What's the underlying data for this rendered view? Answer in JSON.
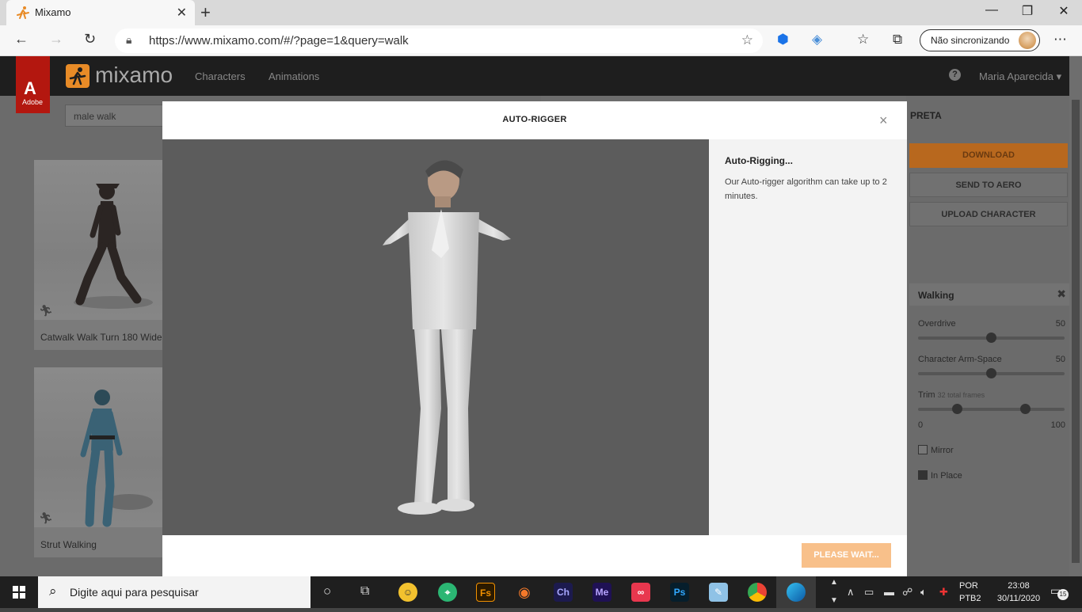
{
  "browser": {
    "tab_title": "Mixamo",
    "tab_close": "✕",
    "new_tab": "+",
    "url": "https://www.mixamo.com/#/?page=1&query=walk",
    "sync_label": "Não sincronizando",
    "minimize": "—",
    "restore": "❐",
    "close": "✕"
  },
  "mixamo": {
    "adobe_label": "Adobe",
    "logo_text": "mixamo",
    "nav": [
      "Characters",
      "Animations"
    ],
    "help": "?",
    "user_name": "Maria Aparecida",
    "search_value": "male walk",
    "cards": [
      {
        "label": "Catwalk Walk Turn 180 Wide"
      },
      {
        "label": "Strut Walking"
      }
    ],
    "right_panel": {
      "title": "PRETA",
      "download": "DOWNLOAD",
      "send_to_aero": "SEND TO AERO",
      "upload_character": "UPLOAD CHARACTER",
      "anim_name": "Walking",
      "sliders": [
        {
          "label": "Overdrive",
          "value": "50",
          "level": 0.5
        },
        {
          "label": "Character Arm-Space",
          "value": "50",
          "level": 0.5
        }
      ],
      "trim_label": "Trim",
      "trim_frames": "32 total frames",
      "trim_min": "0",
      "trim_max": "100",
      "trim_range": [
        0.27,
        0.73
      ],
      "mirror_label": "Mirror",
      "mirror_checked": false,
      "in_place_label": "In Place",
      "in_place_checked": true
    }
  },
  "modal": {
    "title": "AUTO-RIGGER",
    "close": "×",
    "info_title": "Auto-Rigging...",
    "info_body": "Our Auto-rigger algorithm can take up to 2 minutes.",
    "button": "PLEASE WAIT..."
  },
  "taskbar": {
    "search_placeholder": "Digite aqui para pesquisar",
    "lang1": "POR",
    "lang2": "PTB2",
    "time": "23:08",
    "date": "30/11/2020",
    "notifications": "15",
    "apps": [
      "Fs",
      "Ch",
      "Me",
      "Ps"
    ]
  },
  "colors": {
    "accent": "#e88b27",
    "modal_button": "#f8c08a",
    "adobe_red": "#b3170f"
  }
}
